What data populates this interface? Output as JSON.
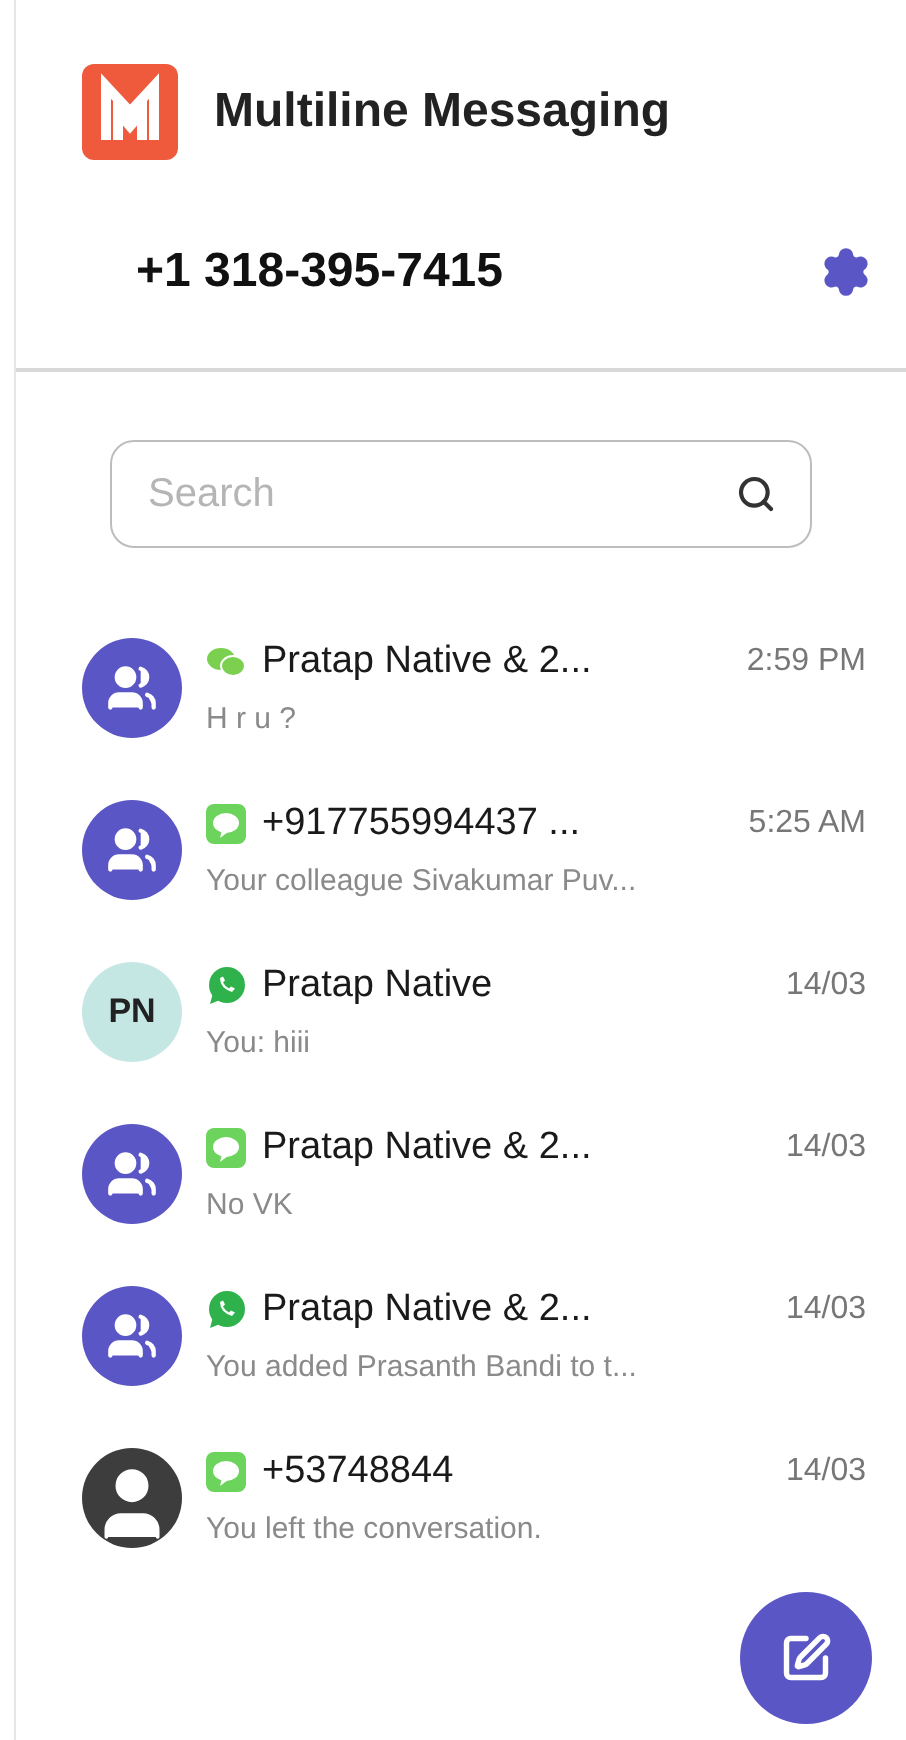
{
  "app": {
    "title": "Multiline Messaging"
  },
  "account": {
    "phone": "+1 318-395-7415"
  },
  "search": {
    "placeholder": "Search"
  },
  "conversations": [
    {
      "avatar": {
        "kind": "group"
      },
      "channel": {
        "kind": "wechat"
      },
      "name": "Pratap Native & 2...",
      "time": "2:59 PM",
      "preview": "H r u ?"
    },
    {
      "avatar": {
        "kind": "group"
      },
      "channel": {
        "kind": "line"
      },
      "name": "+917755994437 ...",
      "time": "5:25 AM",
      "preview": "Your colleague Sivakumar Puv..."
    },
    {
      "avatar": {
        "kind": "initials",
        "initials": "PN"
      },
      "channel": {
        "kind": "whatsapp"
      },
      "name": "Pratap Native",
      "time": "14/03",
      "preview": "You: hiii"
    },
    {
      "avatar": {
        "kind": "group"
      },
      "channel": {
        "kind": "line"
      },
      "name": "Pratap Native & 2...",
      "time": "14/03",
      "preview": "No VK"
    },
    {
      "avatar": {
        "kind": "group"
      },
      "channel": {
        "kind": "whatsapp"
      },
      "name": "Pratap Native & 2...",
      "time": "14/03",
      "preview": "You added Prasanth Bandi to t..."
    },
    {
      "avatar": {
        "kind": "person"
      },
      "channel": {
        "kind": "line"
      },
      "name": "+53748844",
      "time": "14/03",
      "preview": "You left the conversation."
    }
  ]
}
